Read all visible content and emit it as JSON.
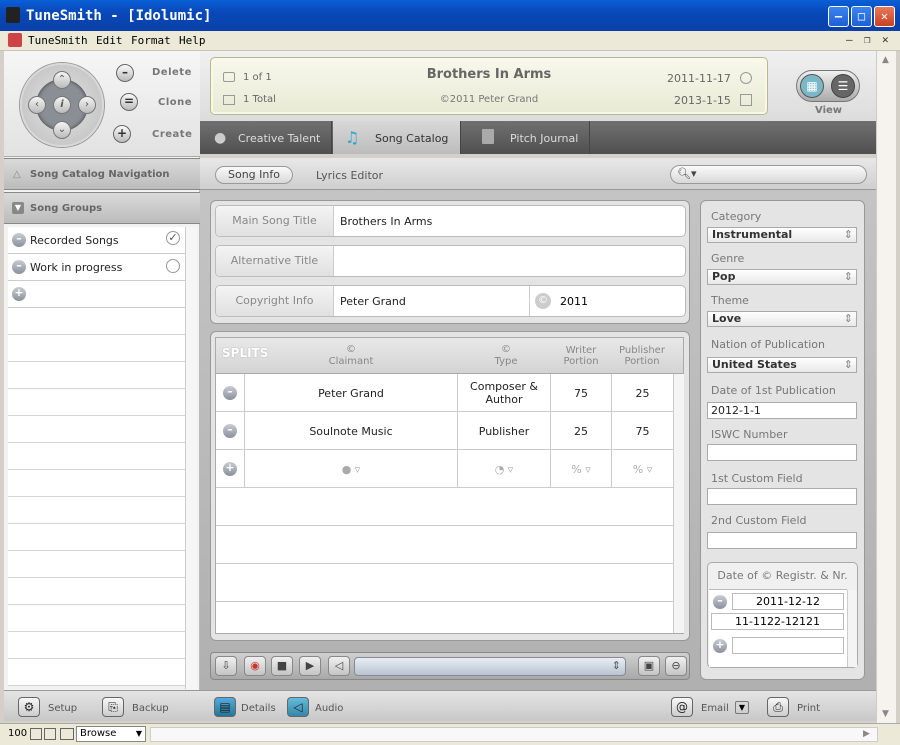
{
  "window": {
    "title": "TuneSmith - [Idolumic]"
  },
  "menu": {
    "items": [
      "TuneSmith",
      "Edit",
      "Format",
      "Help"
    ]
  },
  "controls": {
    "delete": "Delete",
    "clone": "Clone",
    "create": "Create"
  },
  "info": {
    "record_pos": "1 of 1",
    "total": "1 Total",
    "song_title": "Brothers In Arms",
    "copyright": "©2011 Peter Grand",
    "created": "2011-11-17",
    "modified": "2013-1-15"
  },
  "view_label": "View",
  "tabs": [
    "Creative Talent",
    "Song Catalog",
    "Pitch Journal"
  ],
  "subtabs": {
    "song_info": "Song Info",
    "lyrics_editor": "Lyrics Editor"
  },
  "nav": {
    "catalog_nav": "Song Catalog Navigation",
    "groups": "Song Groups",
    "items": [
      "Recorded Songs",
      "Work in progress"
    ]
  },
  "fields": {
    "main_title_label": "Main Song Title",
    "main_title_value": "Brothers In Arms",
    "alt_title_label": "Alternative Title",
    "alt_title_value": "",
    "copyright_label": "Copyright Info",
    "copyright_value": "Peter Grand",
    "copyright_year": "2011"
  },
  "splits": {
    "title": "SPLITS",
    "headers": {
      "claimant_sym": "©",
      "claimant": "Claimant",
      "type_sym": "©",
      "type": "Type",
      "writer1": "Writer",
      "writer2": "Portion",
      "publisher1": "Publisher",
      "publisher2": "Portion"
    },
    "rows": [
      {
        "claimant": "Peter Grand",
        "type": "Composer & Author",
        "writer": "75",
        "publisher": "25"
      },
      {
        "claimant": "Soulnote Music",
        "type": "Publisher",
        "writer": "25",
        "publisher": "75"
      }
    ],
    "add_row": {
      "writer": "%",
      "publisher": "%"
    }
  },
  "right": {
    "category_label": "Category",
    "category": "Instrumental",
    "genre_label": "Genre",
    "genre": "Pop",
    "theme_label": "Theme",
    "theme": "Love",
    "nation_label": "Nation of Publication",
    "nation": "United States",
    "date_label": "Date of 1st Publication",
    "date": "2012-1-1",
    "iswc_label": "ISWC Number",
    "iswc": "",
    "custom1_label": "1st Custom Field",
    "custom1": "",
    "custom2_label": "2nd Custom Field",
    "custom2": "",
    "reg_label": "Date of © Registr. & Nr.",
    "reg_date": "2011-12-12",
    "reg_nr": "11-1122-12121"
  },
  "footer": {
    "setup": "Setup",
    "backup": "Backup",
    "details": "Details",
    "audio": "Audio",
    "email": "Email",
    "print": "Print"
  },
  "status": {
    "zoom": "100",
    "mode": "Browse"
  }
}
